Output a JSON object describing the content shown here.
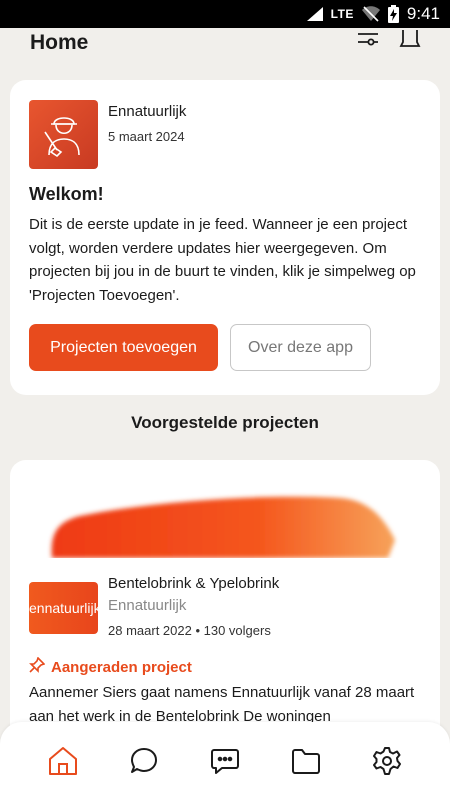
{
  "status_bar": {
    "network": "LTE",
    "time": "9:41"
  },
  "header": {
    "title": "Home",
    "icons": [
      "filter-icon",
      "bell-icon"
    ]
  },
  "welcome_post": {
    "author": "Ennatuurlijk",
    "date": "5 maart 2024",
    "title": "Welkom!",
    "body": "Dit is de eerste update in je feed. Wanneer je een project volgt, worden verdere updates hier weergegeven. Om projecten bij jou in de buurt te vinden, klik je simpelweg op 'Projecten Toevoegen'.",
    "primary_button": "Projecten toevoegen",
    "secondary_button": "Over deze app"
  },
  "suggested": {
    "section_title": "Voorgestelde projecten",
    "project": {
      "logo_text": "ennatuurlijk",
      "title": "Bentelobrink & Ypelobrink",
      "organization": "Ennatuurlijk",
      "stats": "28 maart 2022 • 130 volgers",
      "tag": "Aangeraden project",
      "body": "Aannemer Siers gaat namens Ennatuurlijk vanaf 28 maart aan het werk in de Bentelobrink De woningen"
    }
  },
  "bottom_nav": {
    "items": [
      "home-icon",
      "chat-icon",
      "messages-icon",
      "folder-icon",
      "settings-icon"
    ]
  },
  "colors": {
    "accent": "#e84b1d",
    "background": "#f1efeb"
  }
}
